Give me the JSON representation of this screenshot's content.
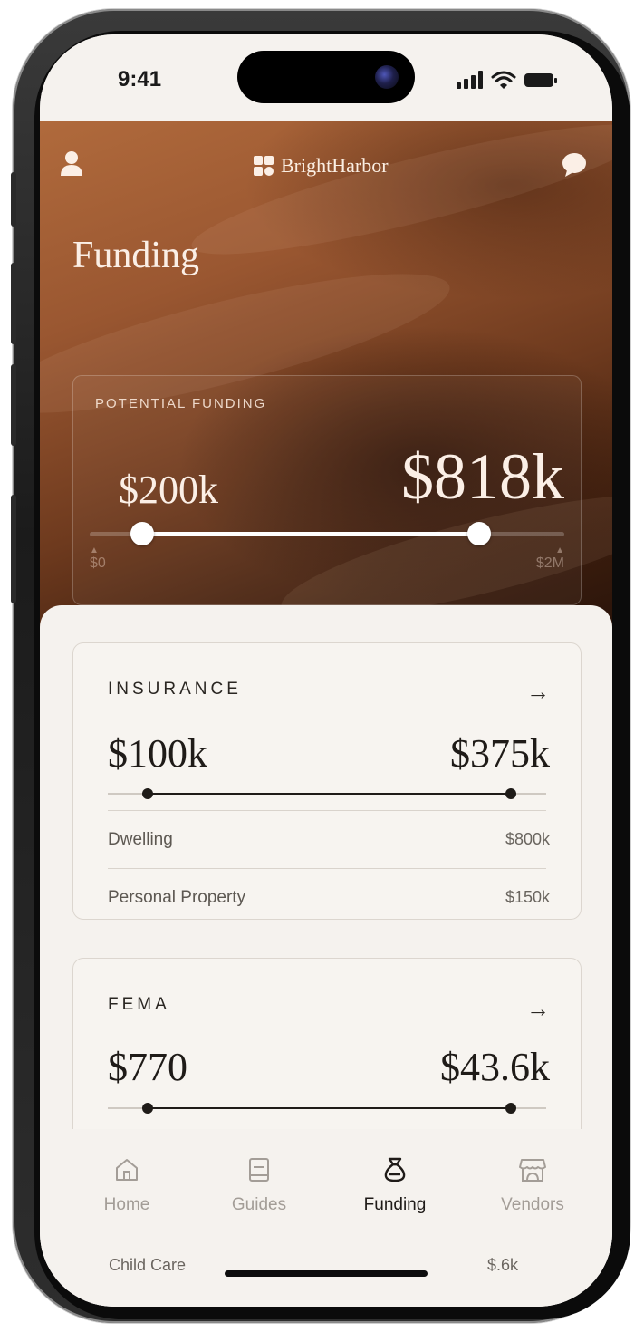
{
  "status": {
    "time": "9:41"
  },
  "header": {
    "brand": "BrightHarbor"
  },
  "page": {
    "title": "Funding"
  },
  "potential_funding": {
    "label": "POTENTIAL FUNDING",
    "low": "$200k",
    "high": "$818k",
    "axis_min": "$0",
    "axis_max": "$2M",
    "range_fraction": [
      0.11,
      0.82
    ]
  },
  "cards": [
    {
      "title": "INSURANCE",
      "low": "$100k",
      "high": "$375k",
      "range_fraction": [
        0.09,
        0.92
      ],
      "rows": [
        {
          "label": "Dwelling",
          "value": "$800k"
        },
        {
          "label": "Personal Property",
          "value": "$150k"
        }
      ]
    },
    {
      "title": "FEMA",
      "low": "$770",
      "high": "$43.6k",
      "range_fraction": [
        0.09,
        0.92
      ]
    }
  ],
  "peek_row": {
    "label": "Child Care",
    "value": "$.6k"
  },
  "tabs": [
    {
      "label": "Home",
      "icon": "home-icon",
      "active": false
    },
    {
      "label": "Guides",
      "icon": "book-icon",
      "active": false
    },
    {
      "label": "Funding",
      "icon": "money-bag-icon",
      "active": true
    },
    {
      "label": "Vendors",
      "icon": "storefront-icon",
      "active": false
    }
  ],
  "colors": {
    "accent": "#1f1b18",
    "hero_brown": "#8a4a28",
    "background": "#f5f2ee",
    "muted": "#a39d97"
  }
}
